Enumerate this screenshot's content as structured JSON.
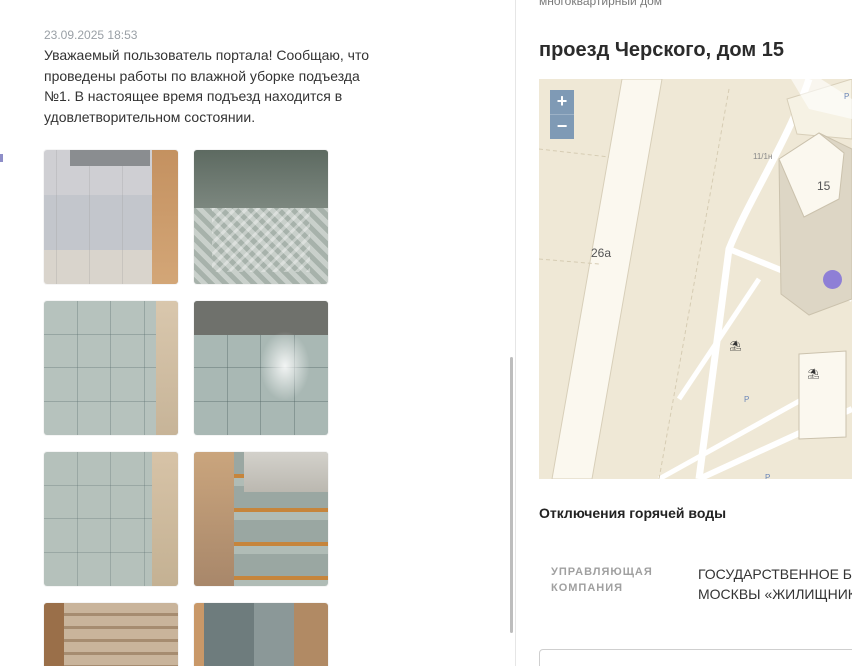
{
  "post": {
    "timestamp": "23.09.2025 18:53",
    "message": "Уважаемый пользователь портала! Сообщаю, что проведены работы по влажной уборке подъезда №1. В настоящее время подъезд находится в удовлетворительном состоянии."
  },
  "building": {
    "type": "многоквартирный дом",
    "address": "проезд Черского, дом 15"
  },
  "map": {
    "zoom_in": "+",
    "zoom_out": "−",
    "labels": {
      "building_15": "15",
      "building_26a": "26а",
      "house_number_small": "11/1н"
    },
    "parking": "P",
    "poi_symbol": "⛱",
    "icons": [
      "zoom-in-icon",
      "zoom-out-icon",
      "location-marker-icon",
      "parking-icon",
      "playground-icon"
    ],
    "location_color": "#8e7fd6"
  },
  "hot_water": {
    "heading": "Отключения горячей воды"
  },
  "management": {
    "label": "Управляющая компания",
    "value_line1": "ГОСУДАРСТВЕННОЕ БЮ",
    "value_line2": "МОСКВЫ «ЖИЛИЩНИК"
  },
  "colors": {
    "map_background": "#efe8d6",
    "zoom_button": "#7f9ab5",
    "muted_text": "#9aa0a6"
  }
}
